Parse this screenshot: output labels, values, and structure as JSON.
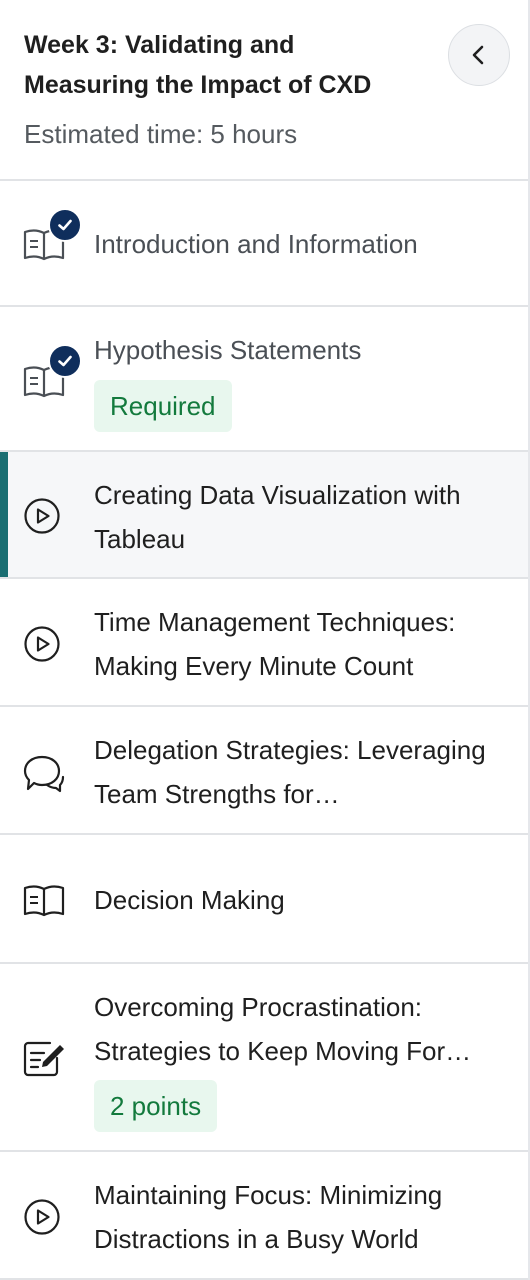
{
  "header": {
    "week_title": "Week 3: Validating and Measuring the Impact of CXD",
    "estimated_time": "Estimated time: 5 hours",
    "collapse_icon": "chevron-left-icon"
  },
  "items": [
    {
      "title": "Introduction and Information",
      "icon": "reading-book-icon",
      "completed": true
    },
    {
      "title": "Hypothesis Statements",
      "icon": "reading-book-icon",
      "completed": true,
      "badge": "Required"
    },
    {
      "title": "Creating Data Visualization with Tableau",
      "icon": "video-play-icon",
      "active": true
    },
    {
      "title": "Time Management Techniques: Making Every Minute Count",
      "icon": "video-play-icon"
    },
    {
      "title": "Delegation Strategies: Leveraging Team Strengths for…",
      "icon": "discussion-icon"
    },
    {
      "title": "Decision Making",
      "icon": "reading-book-icon"
    },
    {
      "title": "Overcoming Procrastination: Strategies to Keep Moving For…",
      "icon": "assignment-edit-icon",
      "badge": "2 points"
    },
    {
      "title": "Maintaining Focus: Minimizing Distractions in a Busy World",
      "icon": "video-play-icon"
    }
  ],
  "colors": {
    "active_bar": "#1a6e72",
    "check_badge": "#0f2e5c",
    "pill_bg": "#e8f7ee",
    "pill_text": "#137a3d"
  }
}
